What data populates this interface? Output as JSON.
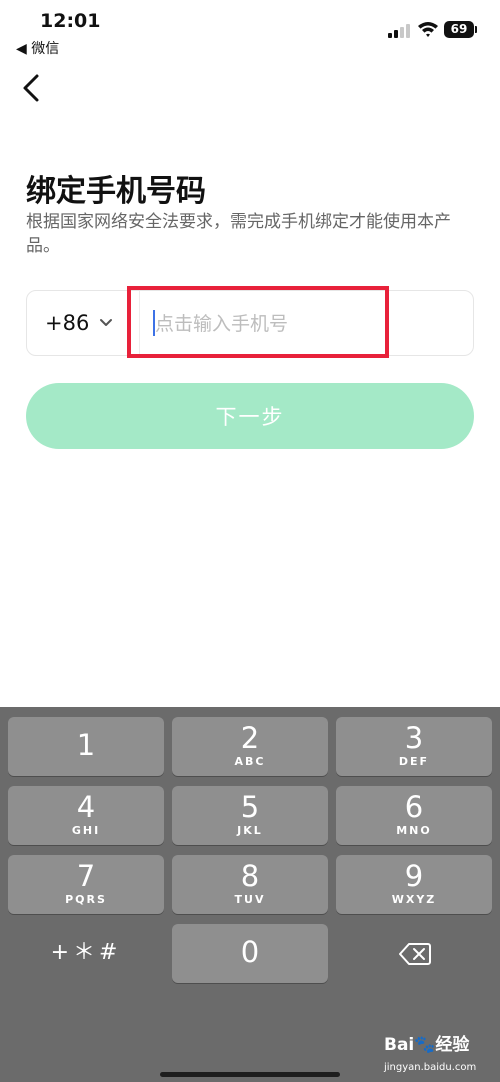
{
  "status_bar": {
    "time": "12:01",
    "back_app": "◀ 微信",
    "battery": "69"
  },
  "page": {
    "title": "绑定手机号码",
    "description": "根据国家网络安全法要求，需完成手机绑定才能使用本产品。"
  },
  "phone_form": {
    "country_code": "+86",
    "placeholder": "点击输入手机号",
    "value": "",
    "next_button": "下一步"
  },
  "keyboard": {
    "keys": [
      {
        "num": "1",
        "letters": ""
      },
      {
        "num": "2",
        "letters": "ABC"
      },
      {
        "num": "3",
        "letters": "DEF"
      },
      {
        "num": "4",
        "letters": "GHI"
      },
      {
        "num": "5",
        "letters": "JKL"
      },
      {
        "num": "6",
        "letters": "MNO"
      },
      {
        "num": "7",
        "letters": "PQRS"
      },
      {
        "num": "8",
        "letters": "TUV"
      },
      {
        "num": "9",
        "letters": "WXYZ"
      },
      {
        "num": "+＊#",
        "letters": ""
      },
      {
        "num": "0",
        "letters": ""
      }
    ],
    "delete_icon": "backspace-icon"
  },
  "watermark": {
    "brand": "Bai🐾经验",
    "url": "jingyan.baidu.com"
  },
  "colors": {
    "accent_button": "#a4e9c7",
    "highlight": "#e8213a",
    "keyboard_bg": "#6b6b6b",
    "key_bg": "#8f8f8f"
  }
}
